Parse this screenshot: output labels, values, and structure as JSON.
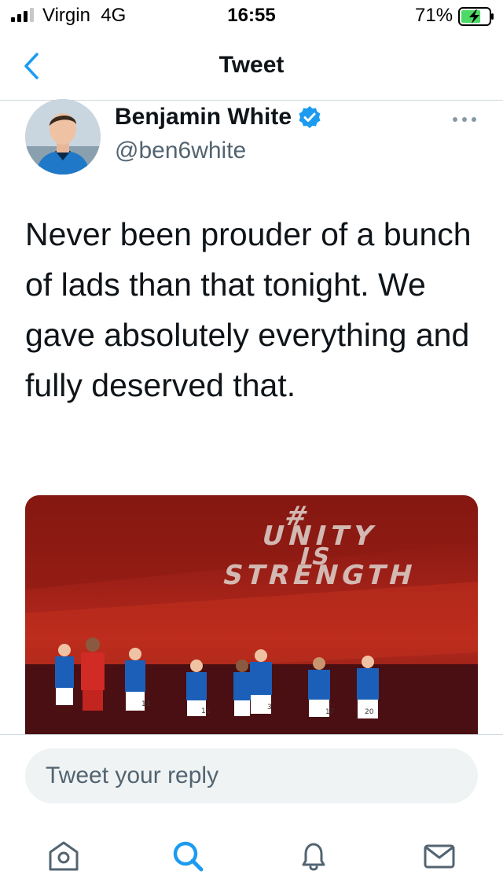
{
  "status_bar": {
    "carrier": "Virgin",
    "network": "4G",
    "time": "16:55",
    "battery": "71%",
    "battery_level": 0.71,
    "battery_color": "#4cd964"
  },
  "header": {
    "title": "Tweet",
    "back_icon": "chevron-left-icon"
  },
  "tweet": {
    "author_name": "Benjamin White",
    "author_handle": "@ben6white",
    "verified": true,
    "verified_color": "#1d9bf0",
    "text": "Never been prouder of a bunch of lads than that tonight. We gave absolutely everything and fully deserved that.",
    "media": {
      "banner_line1": "#",
      "banner_line2": "UNITY",
      "banner_line3": "IS",
      "banner_line4": "STRENGTH",
      "shirt_numbers": [
        "13",
        "11",
        "3",
        "17",
        "20"
      ]
    }
  },
  "reply": {
    "placeholder": "Tweet your reply"
  },
  "tabs": [
    {
      "name": "home",
      "icon": "home-icon",
      "active": false
    },
    {
      "name": "search",
      "icon": "search-icon",
      "active": true
    },
    {
      "name": "notifications",
      "icon": "bell-icon",
      "active": false
    },
    {
      "name": "messages",
      "icon": "mail-icon",
      "active": false
    }
  ],
  "colors": {
    "accent": "#1d9bf0",
    "text_primary": "#0f1419",
    "text_secondary": "#536471",
    "divider": "#cfd9de",
    "reply_bg": "#eff3f4"
  }
}
